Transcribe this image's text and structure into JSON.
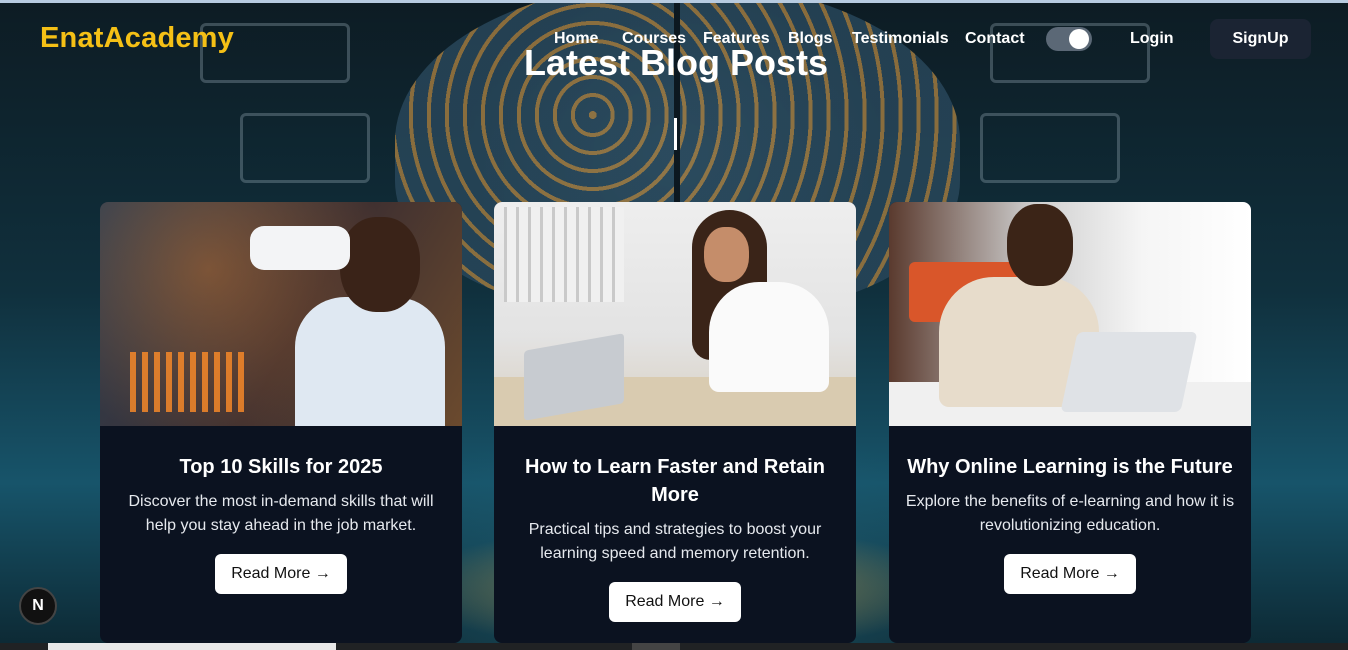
{
  "brand": {
    "name": "EnatAcademy",
    "color": "#f5c016"
  },
  "nav": {
    "links": [
      "Home",
      "Courses",
      "Features",
      "Blogs",
      "Testimonials",
      "Contact"
    ],
    "theme_toggle": "on",
    "login_label": "Login",
    "signup_label": "SignUp"
  },
  "section": {
    "title": "Latest Blog Posts"
  },
  "posts": [
    {
      "title": "Top 10 Skills for 2025",
      "description": "Discover the most in-demand skills that will help you stay ahead in the job market.",
      "button": "Read More →",
      "image_icon": "vr-headset-photo"
    },
    {
      "title": "How to Learn Faster and Retain More",
      "description": "Practical tips and strategies to boost your learning speed and memory retention.",
      "button": "Read More →",
      "image_icon": "studying-with-headphones-photo"
    },
    {
      "title": "Why Online Learning is the Future",
      "description": "Explore the benefits of e-learning and how it is revolutionizing education.",
      "button": "Read More →",
      "image_icon": "online-class-laptop-photo"
    }
  ],
  "devtools_badge": "N"
}
